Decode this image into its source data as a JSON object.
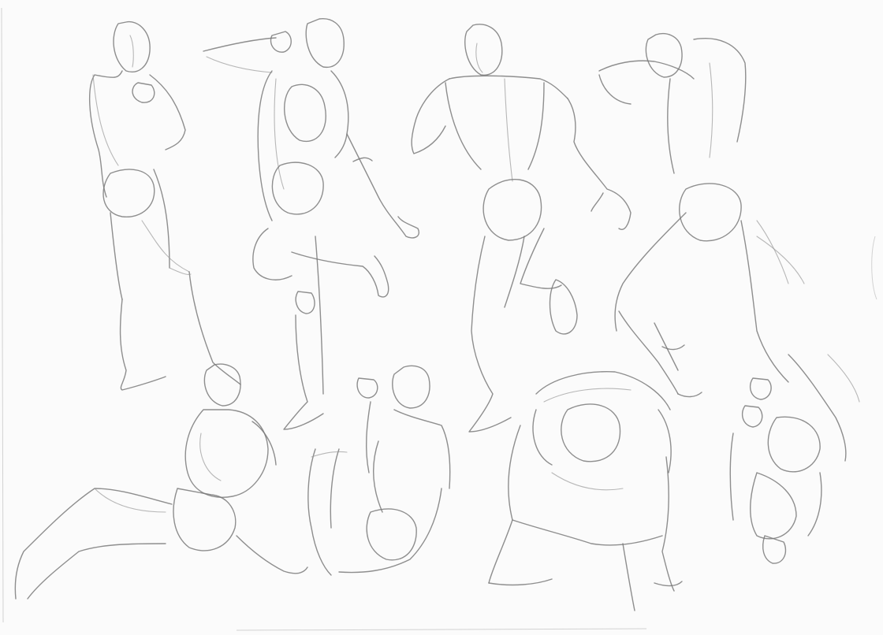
{
  "image": {
    "medium": "pencil",
    "subject": "figure-gesture-sketches",
    "figure_count": 8,
    "colors": {
      "paper": "#fbfbfb",
      "graphite": "#7a7a7a",
      "graphite_light": "#9a9a9a",
      "graphite_dark": "#5a5a5a"
    }
  }
}
